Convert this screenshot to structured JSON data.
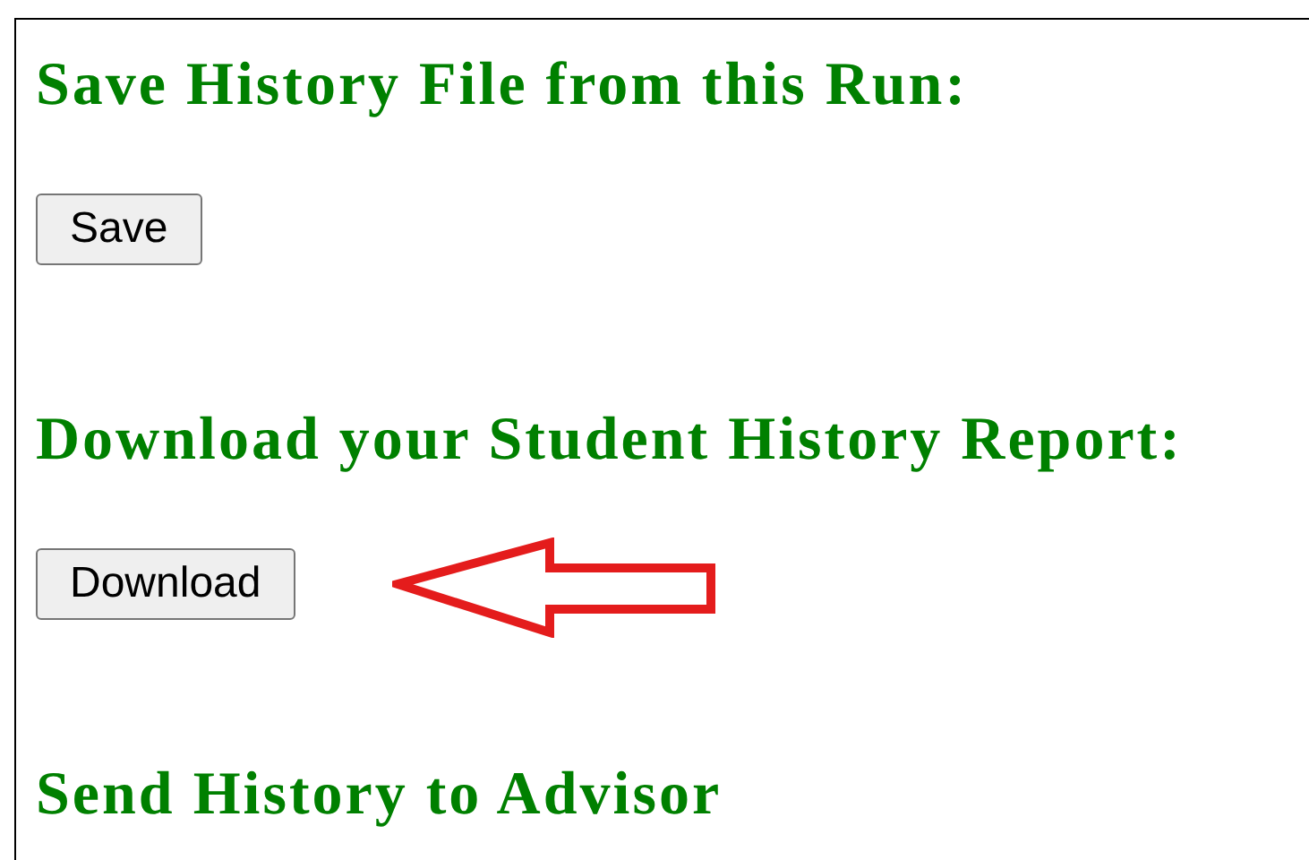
{
  "sections": [
    {
      "heading": "Save History File from this Run:",
      "button": "Save",
      "highlighted": false
    },
    {
      "heading": "Download your Student History Report:",
      "button": "Download",
      "highlighted": true
    },
    {
      "heading": "Send History to Advisor",
      "highlighted": false
    }
  ]
}
